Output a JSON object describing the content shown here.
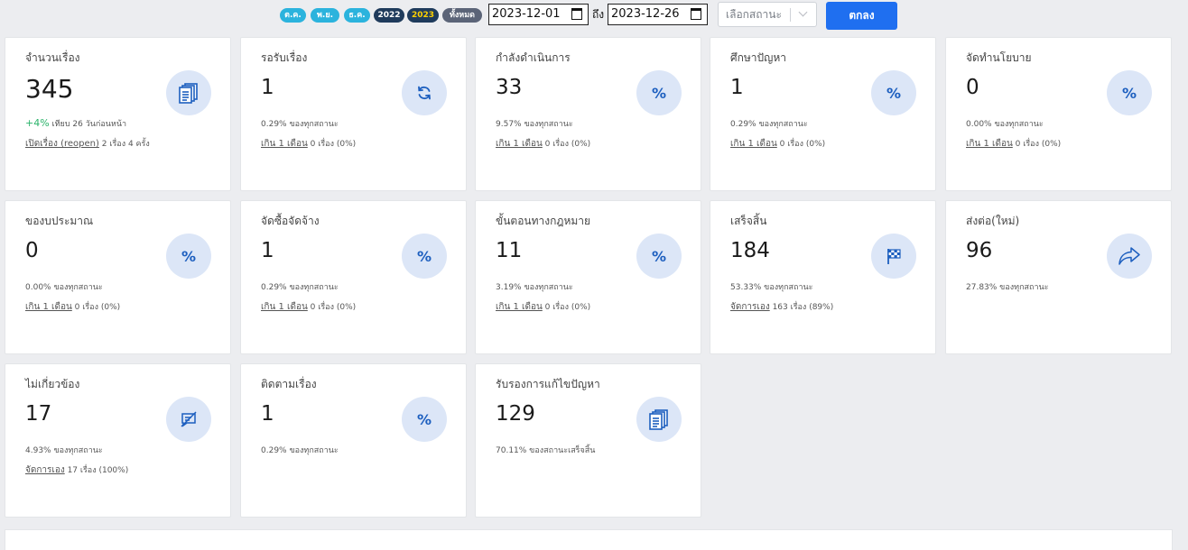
{
  "filters": {
    "pills": [
      {
        "label": "ต.ค.",
        "style": "cyan"
      },
      {
        "label": "พ.ย.",
        "style": "cyan"
      },
      {
        "label": "ธ.ค.",
        "style": "cyan"
      },
      {
        "label": "2022",
        "style": "navy"
      },
      {
        "label": "2023",
        "style": "navy yellow"
      },
      {
        "label": "ทั้งหมด",
        "style": "slate"
      }
    ],
    "date_from": "2023-12-01",
    "to_label": "ถึง",
    "date_to": "2023-12-26",
    "status_select_placeholder": "เลือกสถานะ",
    "ok_label": "ตกลง"
  },
  "cards": [
    {
      "title": "จำนวนเรื่อง",
      "value": "345",
      "icon": "documents-icon",
      "sub_pos": "+4%",
      "sub": "เทียบ 26 วันก่อนหน้า",
      "sub2_link": "เปิดเรื่อง (reopen)",
      "sub2": "2 เรื่อง 4 ครั้ง"
    },
    {
      "title": "รอรับเรื่อง",
      "value": "1",
      "icon": "refresh-icon",
      "sub": "0.29% ของทุกสถานะ",
      "sub2_link": "เกิน 1 เดือน",
      "sub2": "0 เรื่อง (0%)"
    },
    {
      "title": "กำลังดำเนินการ",
      "value": "33",
      "icon": "percent-icon",
      "sub": "9.57% ของทุกสถานะ",
      "sub2_link": "เกิน 1 เดือน",
      "sub2": "0 เรื่อง (0%)"
    },
    {
      "title": "ศึกษาปัญหา",
      "value": "1",
      "icon": "percent-icon",
      "sub": "0.29% ของทุกสถานะ",
      "sub2_link": "เกิน 1 เดือน",
      "sub2": "0 เรื่อง (0%)"
    },
    {
      "title": "จัดทำนโยบาย",
      "value": "0",
      "icon": "percent-icon",
      "sub": "0.00% ของทุกสถานะ",
      "sub2_link": "เกิน 1 เดือน",
      "sub2": "0 เรื่อง (0%)"
    },
    {
      "title": "ของบประมาณ",
      "value": "0",
      "icon": "percent-icon",
      "sub": "0.00% ของทุกสถานะ",
      "sub2_link": "เกิน 1 เดือน",
      "sub2": "0 เรื่อง (0%)"
    },
    {
      "title": "จัดซื้อจัดจ้าง",
      "value": "1",
      "icon": "percent-icon",
      "sub": "0.29% ของทุกสถานะ",
      "sub2_link": "เกิน 1 เดือน",
      "sub2": "0 เรื่อง (0%)"
    },
    {
      "title": "ขั้นตอนทางกฎหมาย",
      "value": "11",
      "icon": "percent-icon",
      "sub": "3.19% ของทุกสถานะ",
      "sub2_link": "เกิน 1 เดือน",
      "sub2": "0 เรื่อง (0%)"
    },
    {
      "title": "เสร็จสิ้น",
      "value": "184",
      "icon": "checkered-flag-icon",
      "sub": "53.33% ของทุกสถานะ",
      "sub2_link": "จัดการเอง",
      "sub2": "163 เรื่อง (89%)"
    },
    {
      "title": "ส่งต่อ(ใหม่)",
      "value": "96",
      "icon": "share-arrow-icon",
      "sub": "27.83% ของทุกสถานะ"
    },
    {
      "title": "ไม่เกี่ยวข้อง",
      "value": "17",
      "icon": "comment-off-icon",
      "sub": "4.93% ของทุกสถานะ",
      "sub2_link": "จัดการเอง",
      "sub2": "17 เรื่อง (100%)"
    },
    {
      "title": "ติดตามเรื่อง",
      "value": "1",
      "icon": "percent-icon",
      "sub": "0.29% ของทุกสถานะ"
    },
    {
      "title": "รับรองการแก้ไขปัญหา",
      "value": "129",
      "icon": "documents-icon",
      "sub": "70.11% ของสถานะเสร็จสิ้น"
    }
  ]
}
